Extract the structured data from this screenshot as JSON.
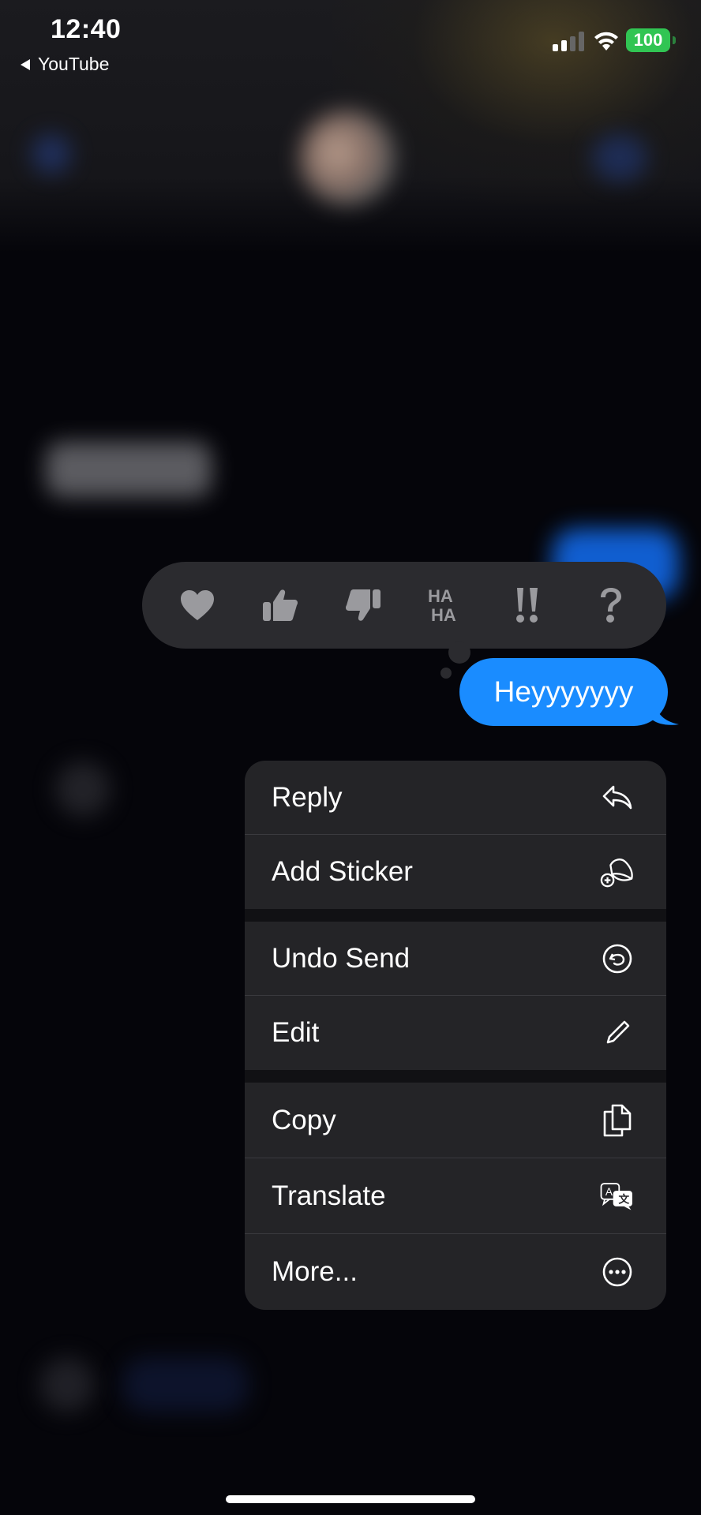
{
  "status_bar": {
    "time": "12:40",
    "back_app": "YouTube",
    "battery": "100"
  },
  "tapbacks": [
    {
      "icon": "heart-icon"
    },
    {
      "icon": "thumbs-up-icon"
    },
    {
      "icon": "thumbs-down-icon"
    },
    {
      "icon": "haha-icon",
      "text": "HA HA"
    },
    {
      "icon": "exclamation-icon",
      "text": "!!"
    },
    {
      "icon": "question-icon",
      "text": "?"
    }
  ],
  "message": {
    "text": "Heyyyyyyy",
    "bubble_color": "#1a8cff"
  },
  "menu": {
    "group1": [
      {
        "label": "Reply",
        "icon": "reply-icon"
      },
      {
        "label": "Add Sticker",
        "icon": "add-sticker-icon"
      }
    ],
    "group2": [
      {
        "label": "Undo Send",
        "icon": "undo-send-icon"
      },
      {
        "label": "Edit",
        "icon": "pencil-icon"
      }
    ],
    "group3": [
      {
        "label": "Copy",
        "icon": "copy-icon"
      },
      {
        "label": "Translate",
        "icon": "translate-icon"
      },
      {
        "label": "More...",
        "icon": "more-icon"
      }
    ]
  },
  "colors": {
    "accent_blue": "#1a8cff",
    "battery_green": "#31c553",
    "menu_bg": "#242427",
    "tapback_bg": "#2b2b2f"
  }
}
